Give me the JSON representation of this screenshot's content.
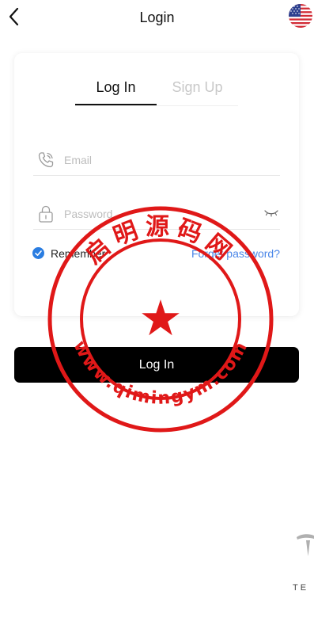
{
  "header": {
    "title": "Login",
    "back_icon": "chevron-left-icon",
    "language_flag": "us-flag-icon"
  },
  "tabs": [
    {
      "label": "Log In",
      "active": true
    },
    {
      "label": "Sign Up",
      "active": false
    }
  ],
  "form": {
    "email": {
      "placeholder": "Email",
      "value": "",
      "icon": "phone-icon"
    },
    "password": {
      "placeholder": "Password",
      "value": "",
      "icon": "lock-icon",
      "toggle_icon": "eye-closed-icon"
    },
    "remember": {
      "label": "Remember",
      "checked": true
    },
    "forgot_link": "Forget password?"
  },
  "submit_label": "Log In",
  "footer": {
    "wordmark": "TE",
    "logo": "brand-logo-icon"
  },
  "watermark": {
    "top_text": "启明源码网",
    "bottom_text": "www.qimingym.com"
  },
  "colors": {
    "accent": "#2a7de1",
    "link": "#4a86e8",
    "button": "#000000",
    "inactive_tab": "#c8c8c8",
    "watermark": "#e01818"
  }
}
